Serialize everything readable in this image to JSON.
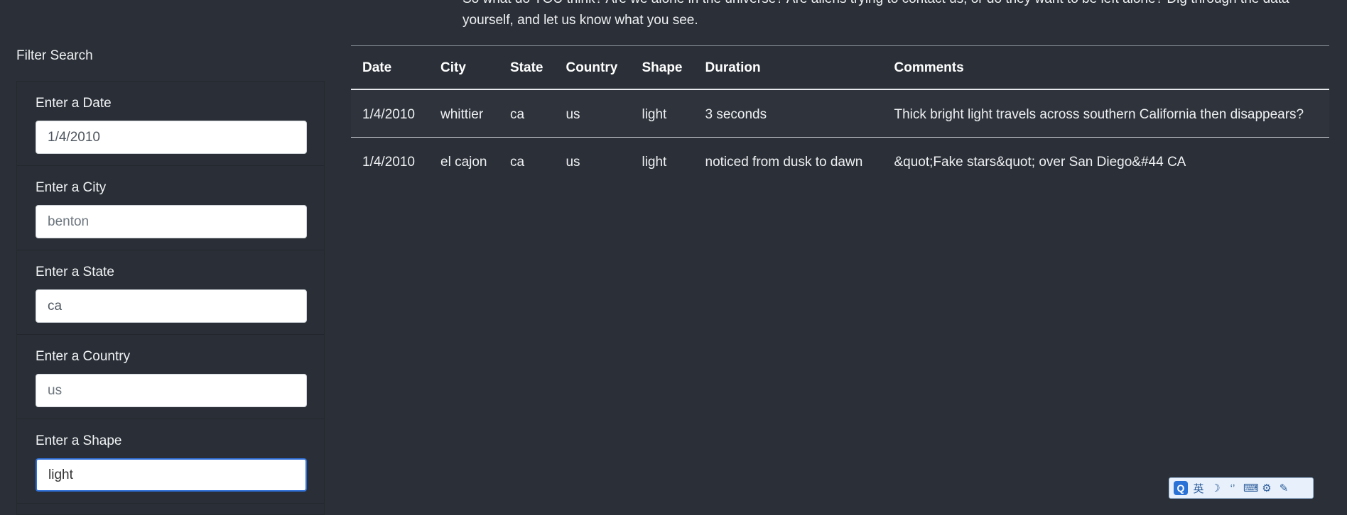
{
  "intro": {
    "text": "So what do YOU think? Are we alone in the universe? Are aliens trying to contact us, or do they want to be left alone? Dig through the data yourself, and let us know what you see."
  },
  "filters": {
    "title": "Filter Search",
    "fields": [
      {
        "label": "Enter a Date",
        "value": "1/4/2010",
        "placeholder": ""
      },
      {
        "label": "Enter a City",
        "value": "",
        "placeholder": "benton"
      },
      {
        "label": "Enter a State",
        "value": "ca",
        "placeholder": ""
      },
      {
        "label": "Enter a Country",
        "value": "",
        "placeholder": "us"
      },
      {
        "label": "Enter a Shape",
        "value": "light",
        "placeholder": ""
      }
    ]
  },
  "table": {
    "headers": [
      "Date",
      "City",
      "State",
      "Country",
      "Shape",
      "Duration",
      "Comments"
    ],
    "rows": [
      [
        "1/4/2010",
        "whittier",
        "ca",
        "us",
        "light",
        "3 seconds",
        "Thick bright light travels across southern California then disappears?"
      ],
      [
        "1/4/2010",
        "el cajon",
        "ca",
        "us",
        "light",
        "noticed from dusk to dawn",
        "&quot;Fake stars&quot; over San Diego&#44 CA"
      ]
    ]
  },
  "ime": {
    "logo": "Q",
    "mode": "英",
    "icons": [
      "moon-icon",
      "punctuation-icon",
      "keyboard-icon",
      "settings-icon",
      "wrench-icon"
    ]
  }
}
